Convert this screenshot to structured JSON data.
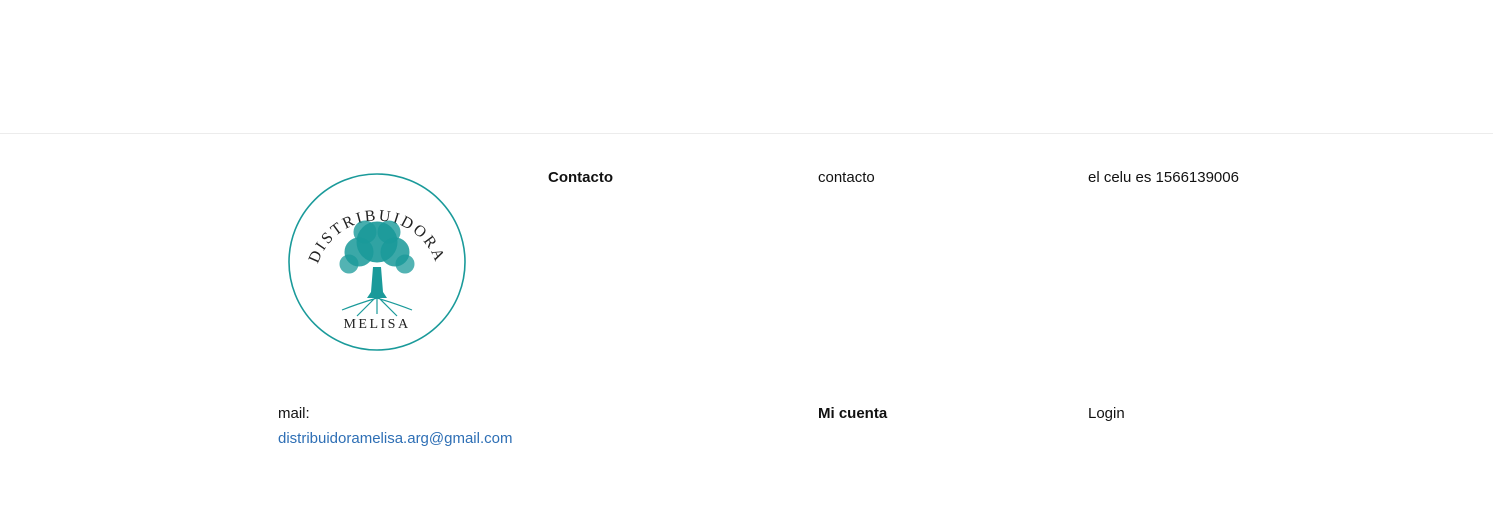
{
  "footer": {
    "logo": {
      "top_text": "DISTRIBUIDORA",
      "bottom_text": "MELISA",
      "icon": "tree-icon",
      "color": "#1a9a9a"
    },
    "contact": {
      "heading": "Contacto",
      "label": "contacto",
      "phone_text": "el celu es 1566139006"
    },
    "mail": {
      "label": "mail:",
      "address": "distribuidoramelisa.arg@gmail.com"
    },
    "account": {
      "heading": "Mi cuenta",
      "login": "Login"
    }
  },
  "colors": {
    "brand": "#1a9a9a",
    "link": "#2e6fb5",
    "divider": "#ececec"
  }
}
